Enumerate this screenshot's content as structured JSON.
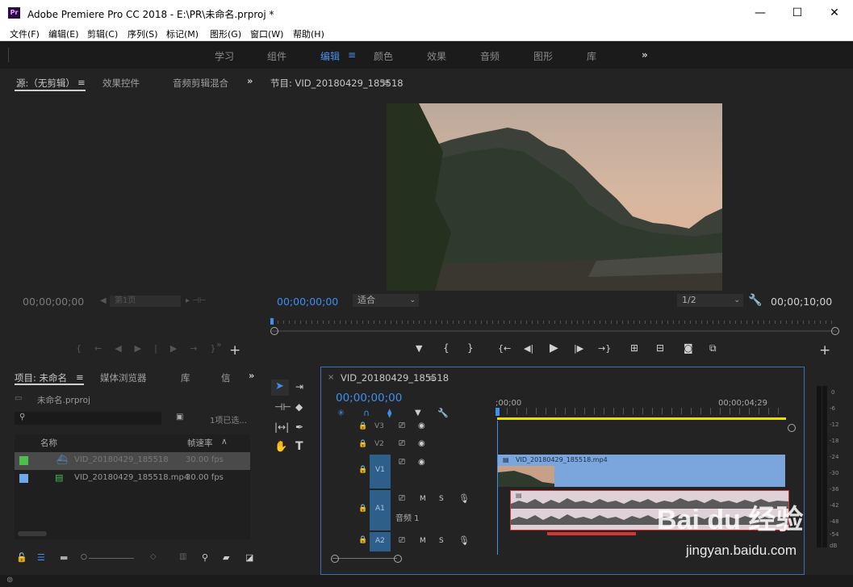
{
  "window": {
    "app_icon": "Pr",
    "title": "Adobe Premiere Pro CC 2018 - E:\\PR\\未命名.prproj *",
    "min": "—",
    "max": "☐",
    "close": "✕"
  },
  "menu": [
    "文件(F)",
    "编辑(E)",
    "剪辑(C)",
    "序列(S)",
    "标记(M)",
    "图形(G)",
    "窗口(W)",
    "帮助(H)"
  ],
  "workspaces": [
    "学习",
    "组件",
    "编辑",
    "颜色",
    "效果",
    "音频",
    "图形",
    "库"
  ],
  "workspace_active": "编辑",
  "workspace_more": "»",
  "source": {
    "tabs": [
      "源:（无剪辑）",
      "效果控件",
      "音频剪辑混合"
    ],
    "timecode": "00;00;00;00",
    "page_label": "第1页"
  },
  "program": {
    "title": "节目: VID_20180429_185518",
    "timecode": "00;00;00;00",
    "fit": "适合",
    "quality": "1/2",
    "duration": "00;00;10;00"
  },
  "project": {
    "tabs": [
      "项目: 未命名",
      "媒体浏览器",
      "库",
      "信"
    ],
    "bin": "未命名.prproj",
    "count": "1项已选...",
    "col_name": "名称",
    "col_fps": "帧速率",
    "items": [
      {
        "name": "VID_20180429_185518",
        "fps": "30.00 fps",
        "color": "#4cbf4c"
      },
      {
        "name": "VID_20180429_185518.mp4",
        "fps": "30.00 fps",
        "color": "#6ea8e8"
      }
    ]
  },
  "timeline": {
    "tab": "VID_20180429_185518",
    "timecode": "00;00;00;00",
    "ruler_start": ";00;00",
    "ruler_mark": "00;00;04;29",
    "tracks": [
      "V3",
      "V2",
      "V1",
      "A1",
      "A2"
    ],
    "track_toggles": {
      "mute": "M",
      "solo": "S"
    },
    "a1_name": "音频 1",
    "clip_name": "VID_20180429_185518.mp4",
    "meter_ticks": [
      "0",
      "-6",
      "-12",
      "-18",
      "-24",
      "-30",
      "-36",
      "-42",
      "-48",
      "-54",
      "dB"
    ]
  },
  "watermark": {
    "text": "Bai du 经验",
    "url": "jingyan.baidu.com"
  },
  "colors": {
    "accent": "#3d8ff0",
    "yellow": "#e8e000",
    "clip_video": "#7aa6dd",
    "clip_audio": "#e0d0d8",
    "selected": "#d03838"
  }
}
